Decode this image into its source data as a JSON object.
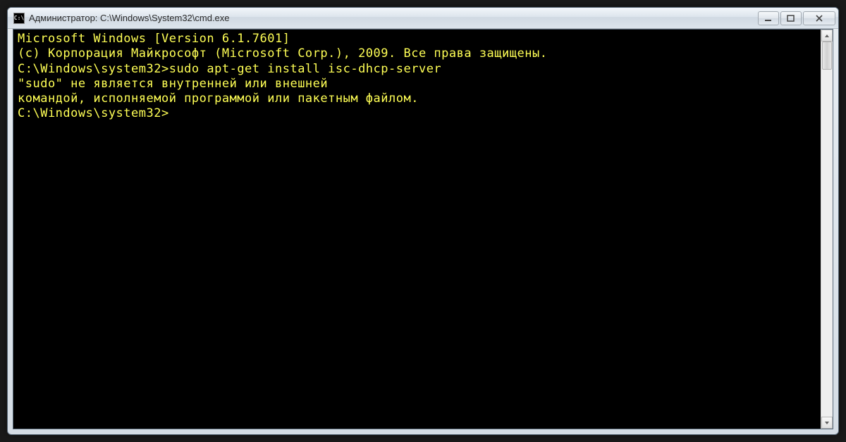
{
  "window": {
    "icon_label": "C:\\",
    "title": "Администратор: C:\\Windows\\System32\\cmd.exe"
  },
  "terminal": {
    "line1": "Microsoft Windows [Version 6.1.7601]",
    "line2": "(c) Корпорация Майкрософт (Microsoft Corp.), 2009. Все права защищены.",
    "prompt1": "C:\\Windows\\system32>",
    "command1": "sudo apt-get install isc-dhcp-server",
    "error1": "\"sudo\" не является внутренней или внешней",
    "error2": "командой, исполняемой программой или пакетным файлом.",
    "prompt2": "C:\\Windows\\system32>"
  }
}
